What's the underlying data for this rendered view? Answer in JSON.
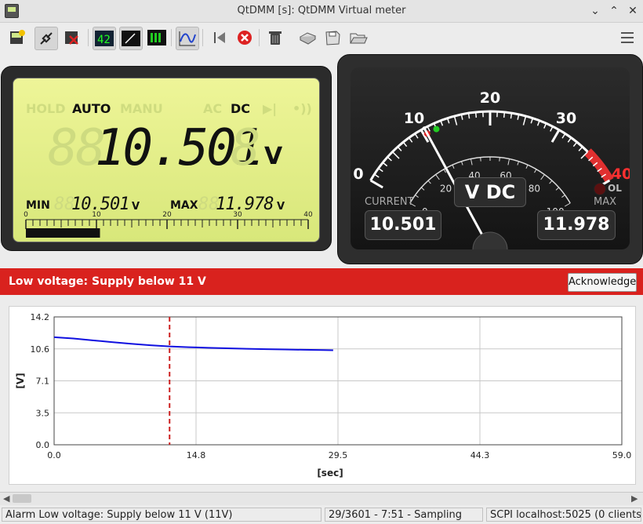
{
  "window": {
    "title": "QtDMM [s]: QtDMM Virtual meter"
  },
  "toolbar": {
    "icons": [
      "connect-config-icon",
      "connect-icon",
      "disconnect-icon",
      "display-numeric-icon",
      "display-analog-icon",
      "display-bargraph-icon",
      "display-graph-icon",
      "reset-min-max-icon",
      "stop-icon",
      "trash-icon",
      "print-icon",
      "save-icon",
      "open-icon",
      "menu-icon"
    ]
  },
  "lcd": {
    "mode_hold": "HOLD",
    "mode_auto": "AUTO",
    "mode_manu": "MANU",
    "mode_ac": "AC",
    "mode_dc": "DC",
    "diode": "▶|",
    "beep": "•))",
    "ghost_digits": "88",
    "value": "10.501",
    "ghost_last": "8",
    "unit": "V",
    "min_label": "MIN",
    "min_ghost": "88",
    "min_value": "10.501",
    "min_unit": "V",
    "max_label": "MAX",
    "max_ghost": "88",
    "max_value": "11.978",
    "max_unit": "V",
    "bar_ticks": [
      "0",
      "10",
      "20",
      "30",
      "40"
    ],
    "bar_fraction": 0.2625
  },
  "gauge": {
    "outer_labels": [
      "0",
      "10",
      "20",
      "30",
      "40"
    ],
    "inner_labels": [
      "0",
      "20",
      "40",
      "60",
      "80",
      "100"
    ],
    "mode": "V DC",
    "current_label": "CURRENT",
    "current_value": "10.501",
    "max_label": "MAX",
    "max_value": "11.978",
    "ol_label": "OL",
    "needle_value": 10.501,
    "min_marker": 10.501,
    "max_marker": 11.978,
    "scale_max": 40
  },
  "alarm": {
    "text": "Low voltage: Supply below 11 V",
    "button": "Acknowledge",
    "color": "#d9221e"
  },
  "chart_data": {
    "type": "line",
    "xlabel": "[sec]",
    "ylabel": "[V]",
    "xlim": [
      0.0,
      59.0
    ],
    "ylim": [
      0.0,
      14.2
    ],
    "xticks": [
      "0.0",
      "14.8",
      "29.5",
      "44.3",
      "59.0"
    ],
    "yticks": [
      "0.0",
      "3.5",
      "7.1",
      "10.6",
      "14.2"
    ],
    "x": [
      0,
      2,
      4,
      6,
      8,
      10,
      12,
      14,
      16,
      18,
      20,
      22,
      24,
      26,
      28,
      29
    ],
    "series": [
      {
        "values": [
          11.95,
          11.8,
          11.6,
          11.4,
          11.22,
          11.05,
          10.92,
          10.84,
          10.77,
          10.71,
          10.66,
          10.62,
          10.58,
          10.55,
          10.52,
          10.5
        ],
        "color": "#1010e0"
      }
    ],
    "marker_x": 12,
    "marker_color": "#cc2020",
    "grid": true
  },
  "status": {
    "alarm": "Alarm Low voltage: Supply below 11 V (11V)",
    "progress": "29/3601 - 7:51 - Sampling",
    "scpi": "SCPI localhost:5025 (0 clients)"
  }
}
